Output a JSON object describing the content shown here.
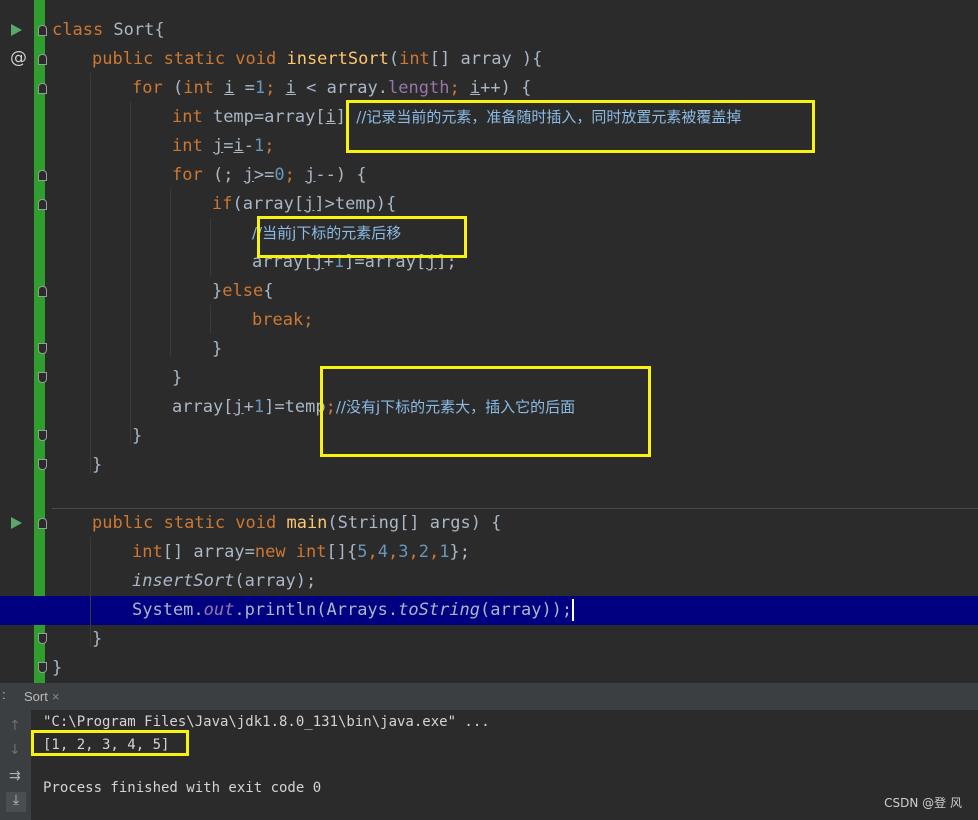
{
  "editor": {
    "lines": {
      "l1": {
        "kw": "class",
        "name": " Sort{"
      },
      "l2": {
        "mods": "public static void ",
        "fn": "insertSort",
        "open": "(",
        "type": "int",
        "rest": "[] array ){"
      },
      "l3": {
        "kw": "for",
        "p1": " (",
        "type": "int",
        "sp1": " ",
        "i1": "i",
        "eq": " =",
        "n1": "1",
        "semi1": "; ",
        "i2": "i",
        "lt": " < array.",
        "fld": "length",
        "semi2": "; ",
        "i3": "i",
        "rest": "++) {"
      },
      "l4": {
        "type": "int",
        "pre": " temp=array[",
        "i": "i",
        "post": "] ",
        "comment": "//记录当前的元素，准备随时插入，同时放置元素被覆盖掉"
      },
      "l5": {
        "type": "int",
        "sp": " ",
        "j": "j",
        "eq": "=",
        "i": "i",
        "minus": "-",
        "n": "1",
        "semi": ";"
      },
      "l6": {
        "kw": "for",
        "p1": " (; ",
        "j1": "j",
        "ge": ">=",
        "n": "0",
        "semi": "; ",
        "j2": "j",
        "rest": "--) {"
      },
      "l7": {
        "kw": "if",
        "pre": "(array[",
        "j": "j",
        "post": "]>temp){"
      },
      "l8": {
        "comment": "//当前j下标的元素后移"
      },
      "l9": {
        "pre": "array[",
        "j1": "j",
        "plus": "+",
        "n": "1",
        "mid": "]=array[",
        "j2": "j",
        "post": "];"
      },
      "l10": {
        "close": "}",
        "kw": "else",
        "open": "{"
      },
      "l11": {
        "kw": "break",
        "semi": ";"
      },
      "l12": {
        "text": "}"
      },
      "l13": {
        "text": "}"
      },
      "l14": {
        "pre": "array[",
        "j": "j",
        "plus": "+",
        "n": "1",
        "mid": "]=temp",
        "semi": ";",
        "comment": "//没有j下标的元素大，插入它的后面"
      },
      "l15": {
        "text": "}"
      },
      "l16": {
        "text": "}"
      },
      "l17": {
        "mods": "public static void ",
        "fn": "main",
        "rest": "(String[] args) {"
      },
      "l18": {
        "type": "int",
        "mid": "[] array=",
        "kw": "new ",
        "type2": "int",
        "pre": "[]{",
        "n1": "5",
        "c1": ",",
        "n2": "4",
        "c2": ",",
        "n3": "3",
        "c3": ",",
        "n4": "2",
        "c4": ",",
        "n5": "1",
        "post": "};"
      },
      "l19": {
        "call": "insertSort",
        "rest": "(array);"
      },
      "l20": {
        "pre": "System.",
        "out": "out",
        "mid": ".println(Arrays.",
        "call": "toString",
        "post": "(array));"
      },
      "l21": {
        "text": "}"
      },
      "l22": {
        "text": "}"
      }
    }
  },
  "console": {
    "tab_label": "Sort",
    "tab_close": "×",
    "colon": ":",
    "command": "\"C:\\Program Files\\Java\\jdk1.8.0_131\\bin\\java.exe\" ...",
    "output": "[1, 2, 3, 4, 5]",
    "finished": "Process finished with exit code 0"
  },
  "watermark": "CSDN @登 风",
  "icons": [
    "run-icon",
    "at-icon",
    "fold-icon",
    "scroll-up-icon",
    "scroll-down-icon",
    "soft-wrap-icon",
    "scroll-to-end-icon"
  ],
  "colors": {
    "keyword": "#cc7832",
    "function": "#ffc66d",
    "number": "#6897bb",
    "field": "#9876aa",
    "comment": "#8bbbe6",
    "highlight": "#000080",
    "annotation_box": "#f7f20e"
  }
}
